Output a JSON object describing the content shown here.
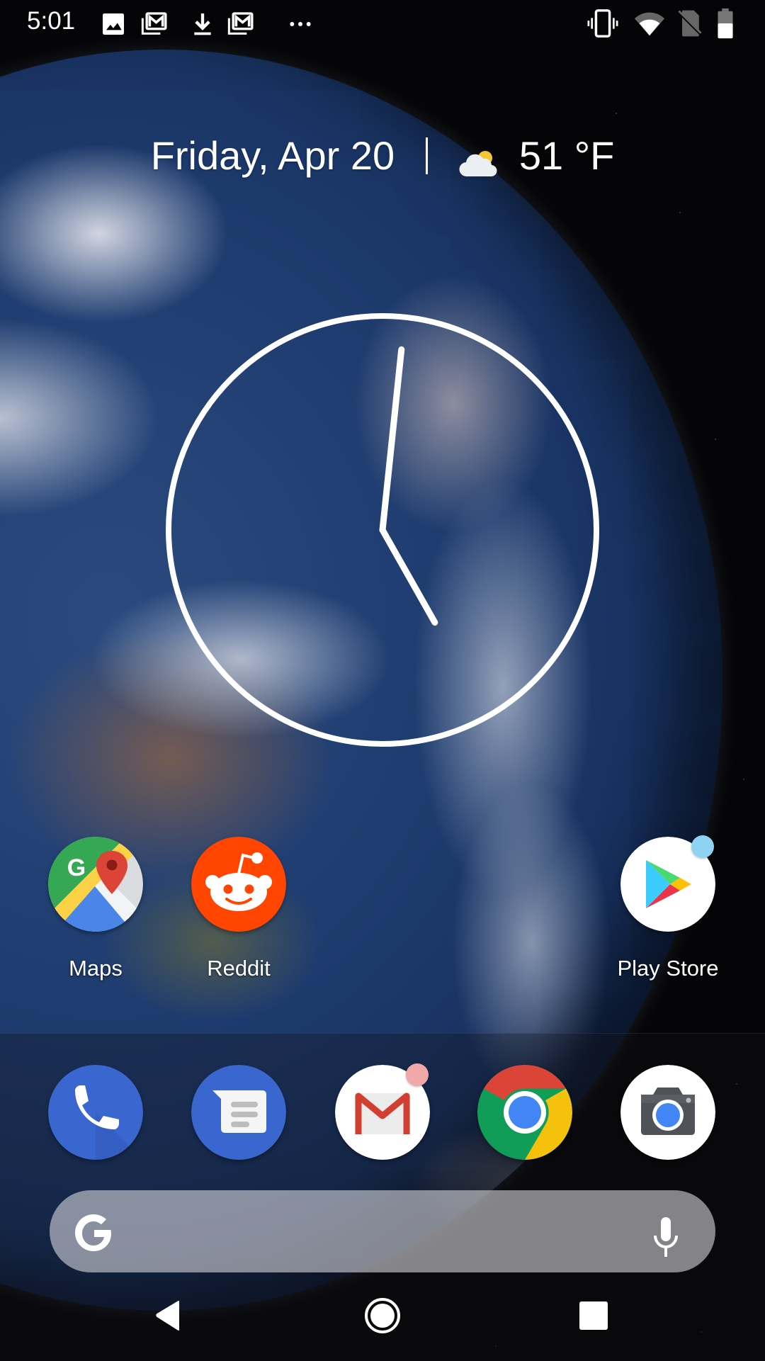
{
  "status_bar": {
    "time": "5:01",
    "left_icons": [
      "image-icon",
      "gmail-notification-icon",
      "download-icon",
      "gmail-notification-icon",
      "more-notifications-icon"
    ],
    "right_icons": [
      "vibrate-icon",
      "wifi-icon",
      "no-sim-icon",
      "battery-icon"
    ],
    "battery_level_fraction": 0.55
  },
  "at_a_glance": {
    "date": "Friday, Apr 20",
    "weather_icon": "partly-cloudy-icon",
    "temperature": "51 °F"
  },
  "clock": {
    "hour": 5,
    "minute": 1
  },
  "home_apps": [
    {
      "name": "Maps",
      "icon": "google-maps-icon",
      "badge": false
    },
    {
      "name": "Reddit",
      "icon": "reddit-icon",
      "badge": false
    },
    {
      "name": "Play Store",
      "icon": "play-store-icon",
      "badge": true,
      "badge_color": "#8fd3f4"
    }
  ],
  "dock_apps": [
    {
      "name": "Phone",
      "icon": "phone-icon",
      "badge": false
    },
    {
      "name": "Messages",
      "icon": "messages-icon",
      "badge": false
    },
    {
      "name": "Gmail",
      "icon": "gmail-icon",
      "badge": true,
      "badge_color": "#f0a8a8"
    },
    {
      "name": "Chrome",
      "icon": "chrome-icon",
      "badge": false
    },
    {
      "name": "Camera",
      "icon": "camera-icon",
      "badge": false
    }
  ],
  "search_bar": {
    "logo": "G",
    "mic_icon": "microphone-icon"
  },
  "nav_bar": {
    "buttons": [
      "back",
      "home",
      "recents"
    ]
  },
  "colors": {
    "reddit_orange": "#ff4500",
    "dock_blue": "#3a66d0",
    "chrome_red": "#db4437",
    "chrome_yellow": "#f4c20d",
    "chrome_green": "#0f9d58",
    "google_blue": "#4285f4"
  }
}
